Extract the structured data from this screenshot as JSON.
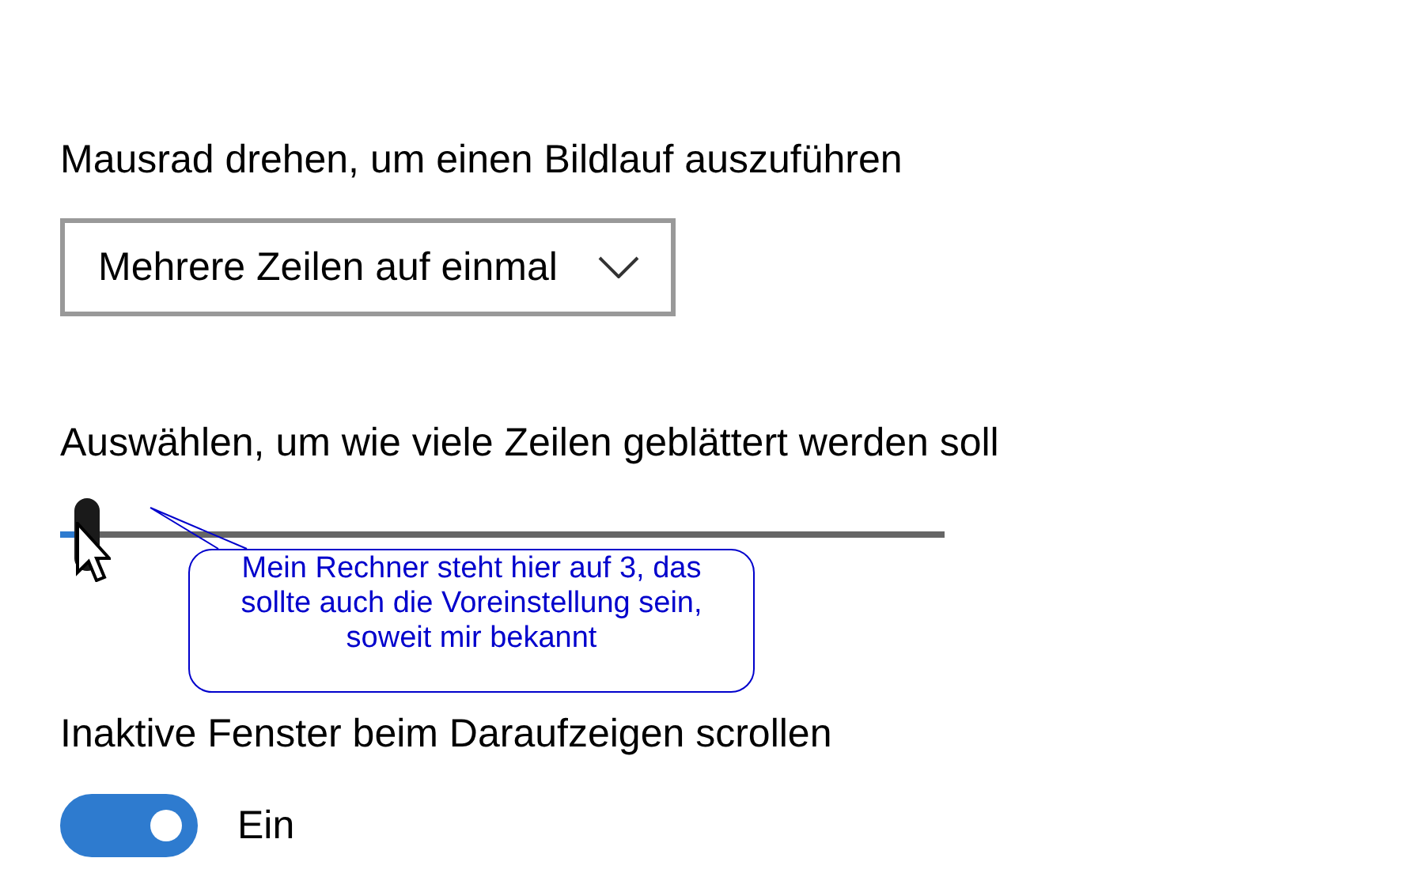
{
  "scroll_mode": {
    "label": "Mausrad drehen, um einen Bildlauf auszuführen",
    "value": "Mehrere Zeilen auf einmal"
  },
  "lines_slider": {
    "label": "Auswählen, um wie viele Zeilen geblättert werden soll",
    "level": 0.03
  },
  "inactive_scroll": {
    "label": "Inaktive Fenster beim Daraufzeigen scrollen",
    "on": true,
    "state_text": "Ein"
  },
  "callout": {
    "text": "Mein Rechner steht hier auf 3, das sollte auch die Voreinstellung sein, soweit mir bekannt"
  }
}
